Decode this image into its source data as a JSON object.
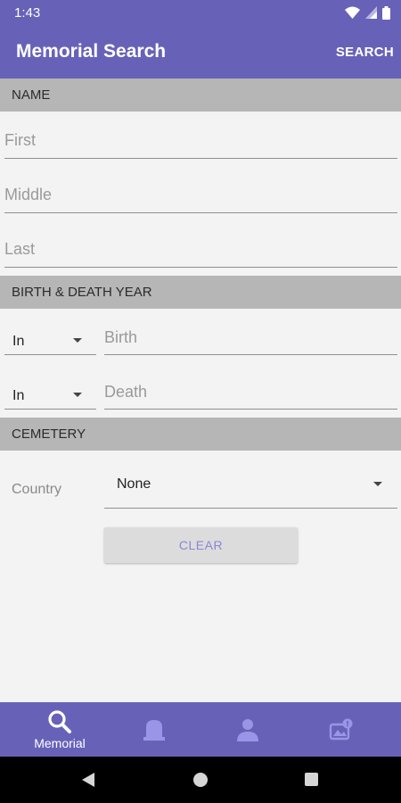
{
  "status_bar": {
    "time": "1:43",
    "icons": [
      "wifi-icon",
      "cell-signal-icon",
      "battery-icon"
    ]
  },
  "app_bar": {
    "title": "Memorial Search",
    "action_label": "SEARCH"
  },
  "sections": {
    "name": {
      "header": "NAME",
      "first_placeholder": "First",
      "middle_placeholder": "Middle",
      "last_placeholder": "Last"
    },
    "years": {
      "header": "BIRTH & DEATH YEAR",
      "birth_qualifier": "In",
      "birth_placeholder": "Birth",
      "death_qualifier": "In",
      "death_placeholder": "Death"
    },
    "cemetery": {
      "header": "CEMETERY",
      "country_label": "Country",
      "country_value": "None",
      "clear_label": "CLEAR"
    }
  },
  "bottom_nav": {
    "items": [
      {
        "label": "Memorial",
        "icon": "search-icon",
        "active": true
      },
      {
        "label": "",
        "icon": "gravestone-icon",
        "active": false
      },
      {
        "label": "",
        "icon": "person-icon",
        "active": false
      },
      {
        "label": "",
        "icon": "photo-request-icon",
        "active": false
      }
    ]
  },
  "colors": {
    "primary": "#6762b8",
    "section_header": "#b6b6b6",
    "background": "#f2f3f2",
    "clear_text": "#8a86d8",
    "inactive_nav_icon": "#9a95e6"
  }
}
